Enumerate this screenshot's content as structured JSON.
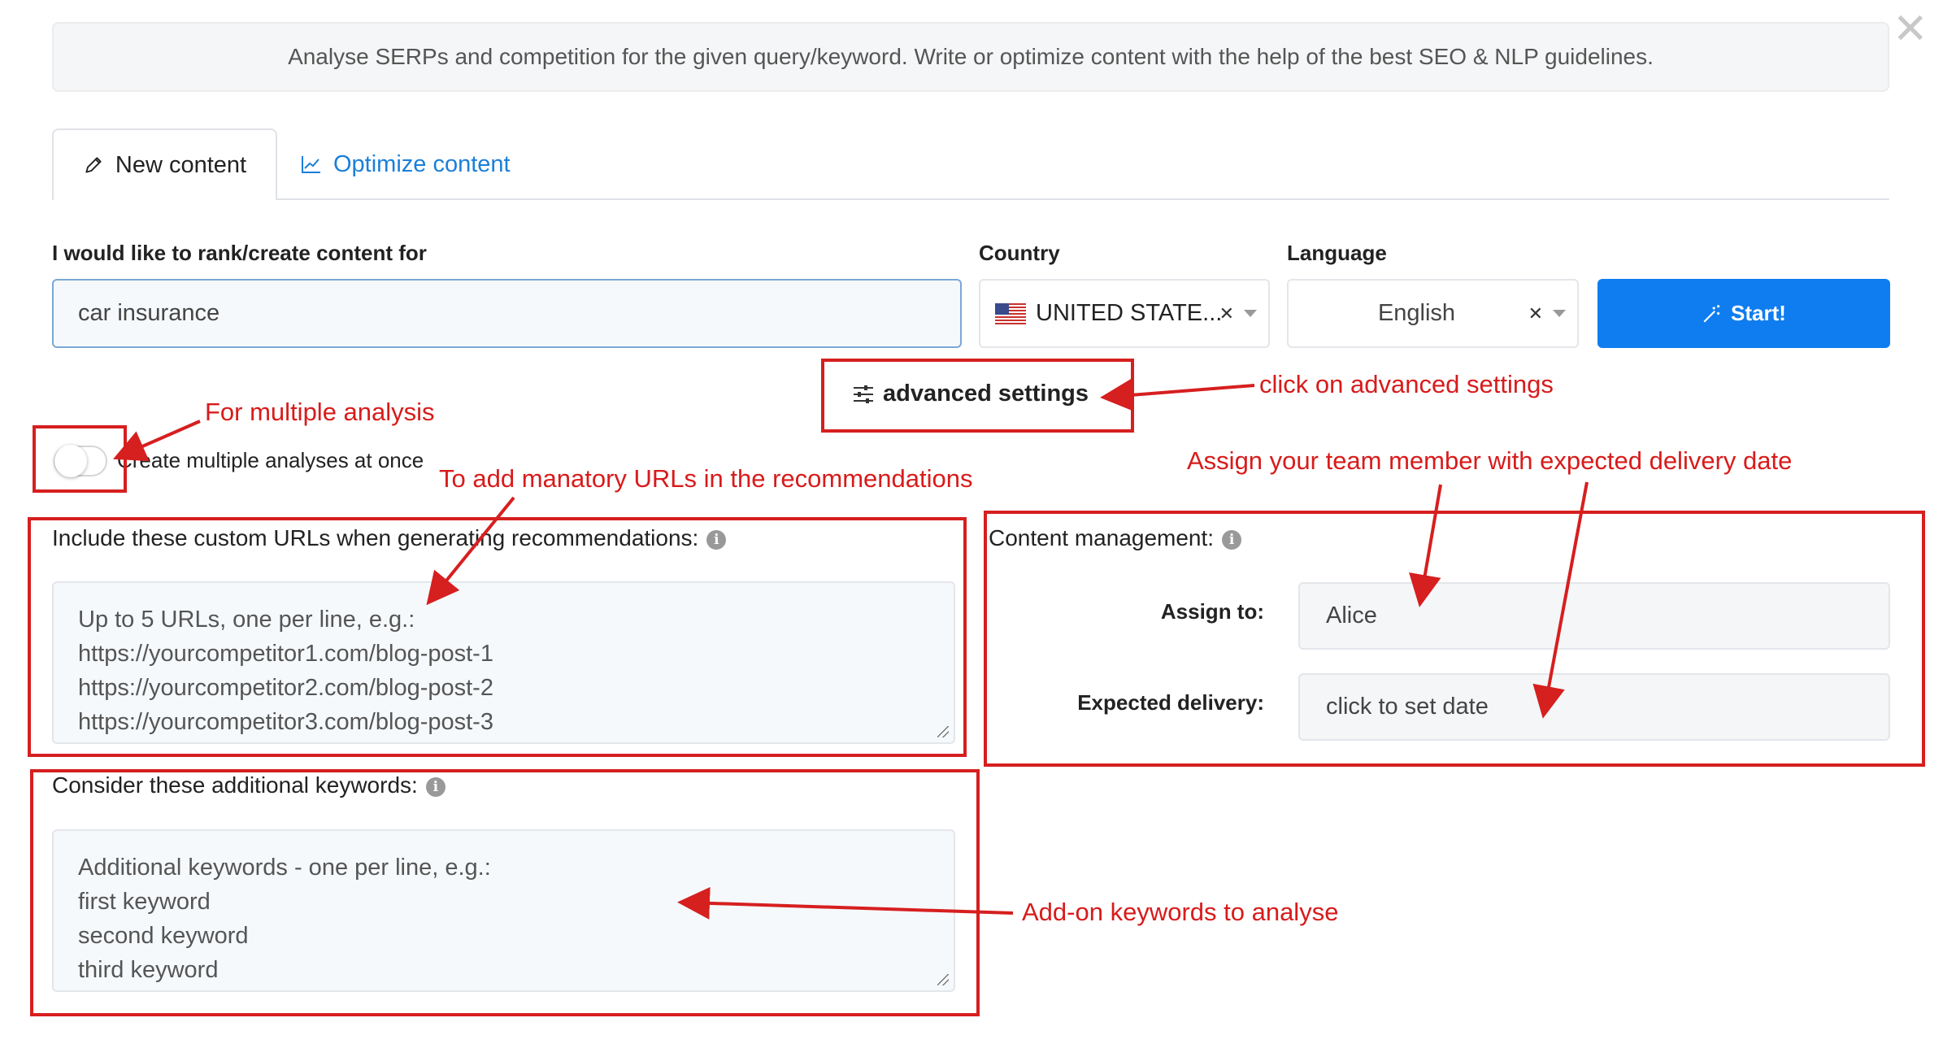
{
  "banner": {
    "text": "Analyse SERPs and competition for the given query/keyword. Write or optimize content with the help of the best SEO & NLP guidelines."
  },
  "tabs": [
    {
      "label": "New content",
      "icon": "pencil-icon",
      "active": true
    },
    {
      "label": "Optimize content",
      "icon": "chart-icon",
      "active": false
    }
  ],
  "form": {
    "keyword_label": "I would like to rank/create content for",
    "keyword_value": "car insurance",
    "country_label": "Country",
    "country_value": "UNITED STATE...",
    "language_label": "Language",
    "language_value": "English",
    "start_label": "Start!",
    "advanced_label": "advanced settings",
    "multi_toggle_label": "Create multiple analyses at once"
  },
  "custom_urls": {
    "label": "Include these custom URLs when generating recommendations:",
    "placeholder_lines": [
      "Up to 5 URLs, one per line, e.g.:",
      "https://yourcompetitor1.com/blog-post-1",
      "https://yourcompetitor2.com/blog-post-2",
      "https://yourcompetitor3.com/blog-post-3"
    ]
  },
  "additional_keywords": {
    "label": "Consider these additional keywords:",
    "placeholder_lines": [
      "Additional keywords - one per line, e.g.:",
      "first keyword",
      "second keyword",
      "third keyword"
    ]
  },
  "content_management": {
    "label": "Content management:",
    "assign_label": "Assign to:",
    "assign_value": "Alice",
    "delivery_label": "Expected delivery:",
    "delivery_placeholder": "click to set date"
  },
  "annotations": {
    "multiple": "For multiple analysis",
    "advanced": "click on advanced settings",
    "urls": "To add manatory URLs in the recommendations",
    "team": "Assign your team member with expected delivery date",
    "keywords": "Add-on keywords to analyse"
  },
  "colors": {
    "accent": "#0f7df0",
    "annotation": "#d61f1f",
    "link": "#1a7fd9"
  }
}
